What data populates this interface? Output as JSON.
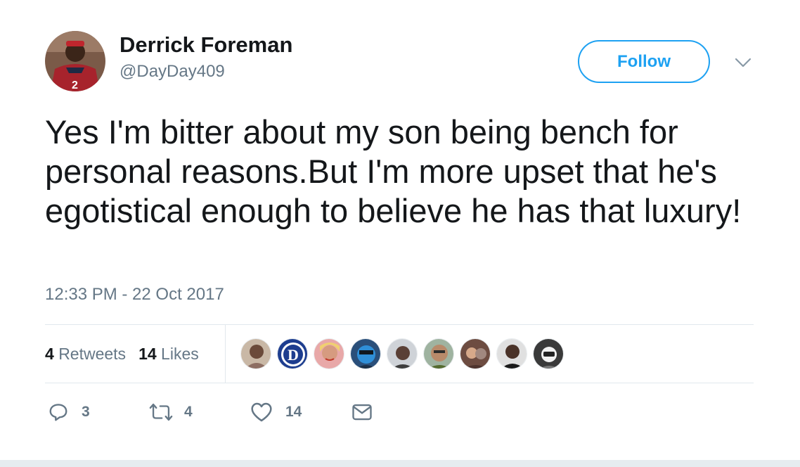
{
  "user": {
    "display_name": "Derrick Foreman",
    "handle": "@DayDay409"
  },
  "follow_button": {
    "label": "Follow"
  },
  "tweet": {
    "text": "Yes I'm bitter about my son being bench for personal reasons.But I'm more upset that he's egotistical enough to believe he has that luxury!",
    "timestamp": "12:33 PM - 22 Oct 2017"
  },
  "stats": {
    "retweets_count": "4",
    "retweets_label": "Retweets",
    "likes_count": "14",
    "likes_label": "Likes"
  },
  "actions": {
    "reply_count": "3",
    "retweet_count": "4",
    "like_count": "14"
  },
  "colors": {
    "accent": "#1da1f2",
    "text_primary": "#14171a",
    "text_secondary": "#657786",
    "divider": "#e1e8ed"
  },
  "icons": {
    "reply": "reply-icon",
    "retweet": "retweet-icon",
    "like": "heart-icon",
    "message": "envelope-icon",
    "menu": "chevron-down-icon"
  },
  "likers": [
    "liker-1",
    "liker-2",
    "liker-3",
    "liker-4",
    "liker-5",
    "liker-6",
    "liker-7",
    "liker-8",
    "liker-9"
  ]
}
